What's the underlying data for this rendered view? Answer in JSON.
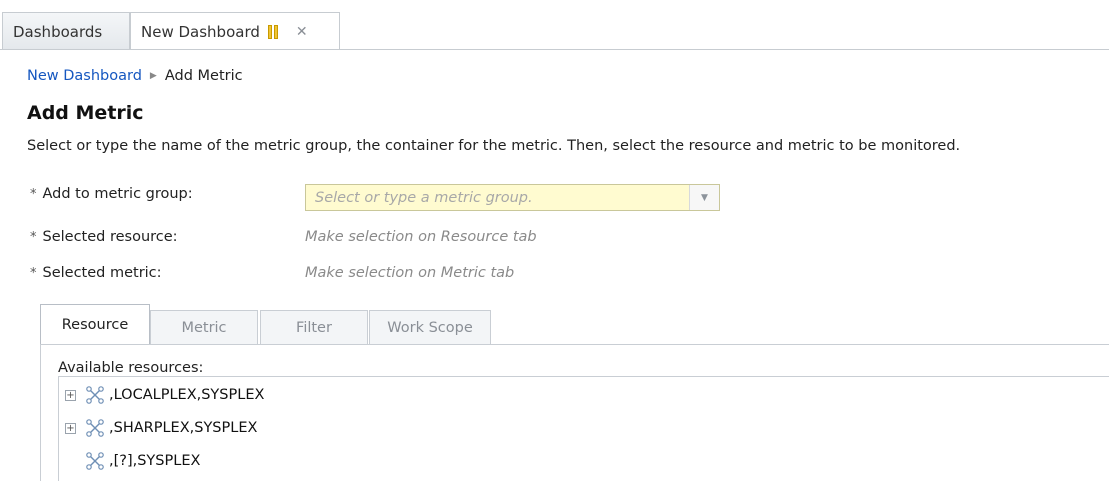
{
  "tabs": {
    "dashboards_label": "Dashboards",
    "new_dashboard_label": "New Dashboard"
  },
  "breadcrumb": {
    "parent": "New Dashboard",
    "current": "Add Metric"
  },
  "page": {
    "title": "Add Metric",
    "description": "Select or type the name of the metric group, the container for the metric. Then, select the resource and metric to be monitored."
  },
  "form": {
    "required_marker": "*",
    "metric_group_label": "Add to metric group:",
    "metric_group_value": "",
    "metric_group_placeholder": "Select or type a metric group.",
    "resource_label": "Selected resource:",
    "resource_hint": "Make selection on Resource tab",
    "metric_label": "Selected metric:",
    "metric_hint": "Make selection on Metric tab"
  },
  "inner_tabs": [
    {
      "label": "Resource",
      "active": true
    },
    {
      "label": "Metric",
      "active": false
    },
    {
      "label": "Filter",
      "active": false
    },
    {
      "label": "Work Scope",
      "active": false
    }
  ],
  "resources": {
    "label": "Available resources:",
    "items": [
      {
        "name": ",LOCALPLEX,SYSPLEX",
        "expandable": true,
        "icon": "sysplex-icon"
      },
      {
        "name": ",SHARPLEX,SYSPLEX",
        "expandable": true,
        "icon": "sysplex-icon"
      },
      {
        "name": ",[?],SYSPLEX",
        "expandable": false,
        "icon": "sysplex-icon"
      }
    ]
  },
  "colors": {
    "link": "#1557c0",
    "combo_background": "#fffbd0",
    "pause_icon": "#f0c436"
  }
}
